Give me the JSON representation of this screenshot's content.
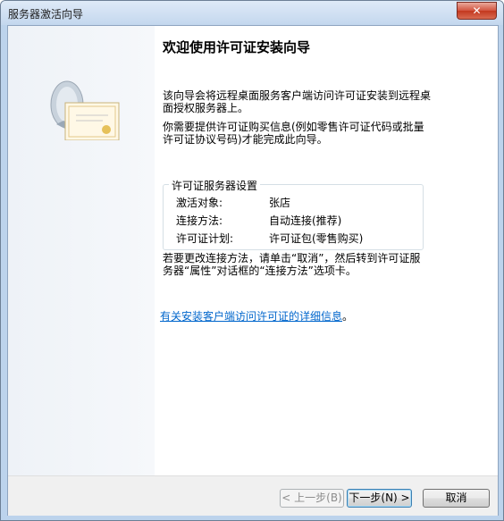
{
  "window": {
    "title": "服务器激活向导"
  },
  "page": {
    "heading": "欢迎使用许可证安装向导",
    "para1": "该向导会将远程桌面服务客户端访问许可证安装到远程桌面授权服务器上。",
    "para2": "你需要提供许可证购买信息(例如零售许可证代码或批量许可证协议号码)才能完成此向导。",
    "settings": {
      "title": "许可证服务器设置",
      "rows": [
        {
          "label": "激活对象:",
          "value": "张店"
        },
        {
          "label": "连接方法:",
          "value": "自动连接(推荐)"
        },
        {
          "label": "许可证计划:",
          "value": "许可证包(零售购买)"
        }
      ]
    },
    "para3": "若要更改连接方法，请单击“取消”，然后转到许可证服务器“属性”对话框的“连接方法”选项卡。",
    "link_text": "有关安装客户端访问许可证的详细信息",
    "link_suffix": "。"
  },
  "buttons": {
    "back": "< 上一步(B)",
    "next": "下一步(N) >",
    "cancel": "取消"
  },
  "icons": {
    "close": "close-icon",
    "illustration": "license-server-icon"
  }
}
